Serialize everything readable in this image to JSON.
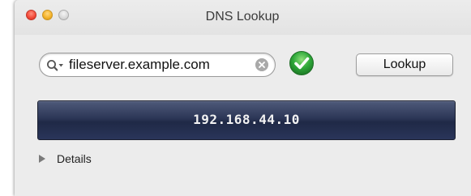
{
  "window": {
    "title": "DNS Lookup"
  },
  "search": {
    "value": "fileserver.example.com",
    "placeholder": ""
  },
  "toolbar": {
    "lookup_label": "Lookup"
  },
  "result": {
    "address": "192.168.44.10"
  },
  "details": {
    "label": "Details"
  },
  "icons": {
    "search": "search-icon",
    "clear": "clear-icon",
    "status": "checkmark-icon",
    "disclosure": "disclosure-triangle-icon"
  },
  "colors": {
    "status_success": "#2fa83a",
    "close": "#f44d3c",
    "minimize": "#f5b42c",
    "result_panel": "#2c3656"
  }
}
